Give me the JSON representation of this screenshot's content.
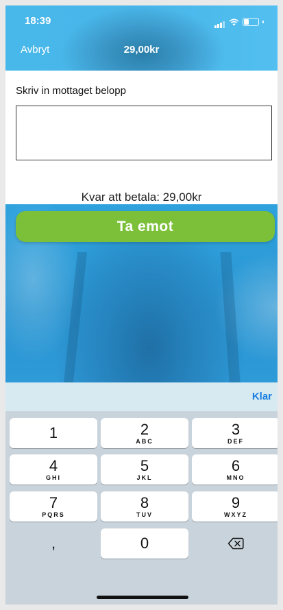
{
  "status_bar": {
    "time": "18:39"
  },
  "nav": {
    "cancel": "Avbryt",
    "title": "29,00kr"
  },
  "form": {
    "label": "Skriv in mottaget belopp",
    "amount_value": "",
    "remaining": "Kvar att betala: 29,00kr"
  },
  "action": {
    "take_label": "Ta emot"
  },
  "keyboard": {
    "done": "Klar",
    "keys": [
      {
        "num": "1",
        "letters": ""
      },
      {
        "num": "2",
        "letters": "ABC"
      },
      {
        "num": "3",
        "letters": "DEF"
      },
      {
        "num": "4",
        "letters": "GHI"
      },
      {
        "num": "5",
        "letters": "JKL"
      },
      {
        "num": "6",
        "letters": "MNO"
      },
      {
        "num": "7",
        "letters": "PQRS"
      },
      {
        "num": "8",
        "letters": "TUV"
      },
      {
        "num": "9",
        "letters": "WXYZ"
      },
      {
        "num": ",",
        "letters": ""
      },
      {
        "num": "0",
        "letters": ""
      },
      {
        "num": "",
        "letters": ""
      }
    ]
  },
  "colors": {
    "accent_green": "#7cc03a",
    "done_blue": "#1a7fe0",
    "background_blue": "#48b7ea"
  }
}
